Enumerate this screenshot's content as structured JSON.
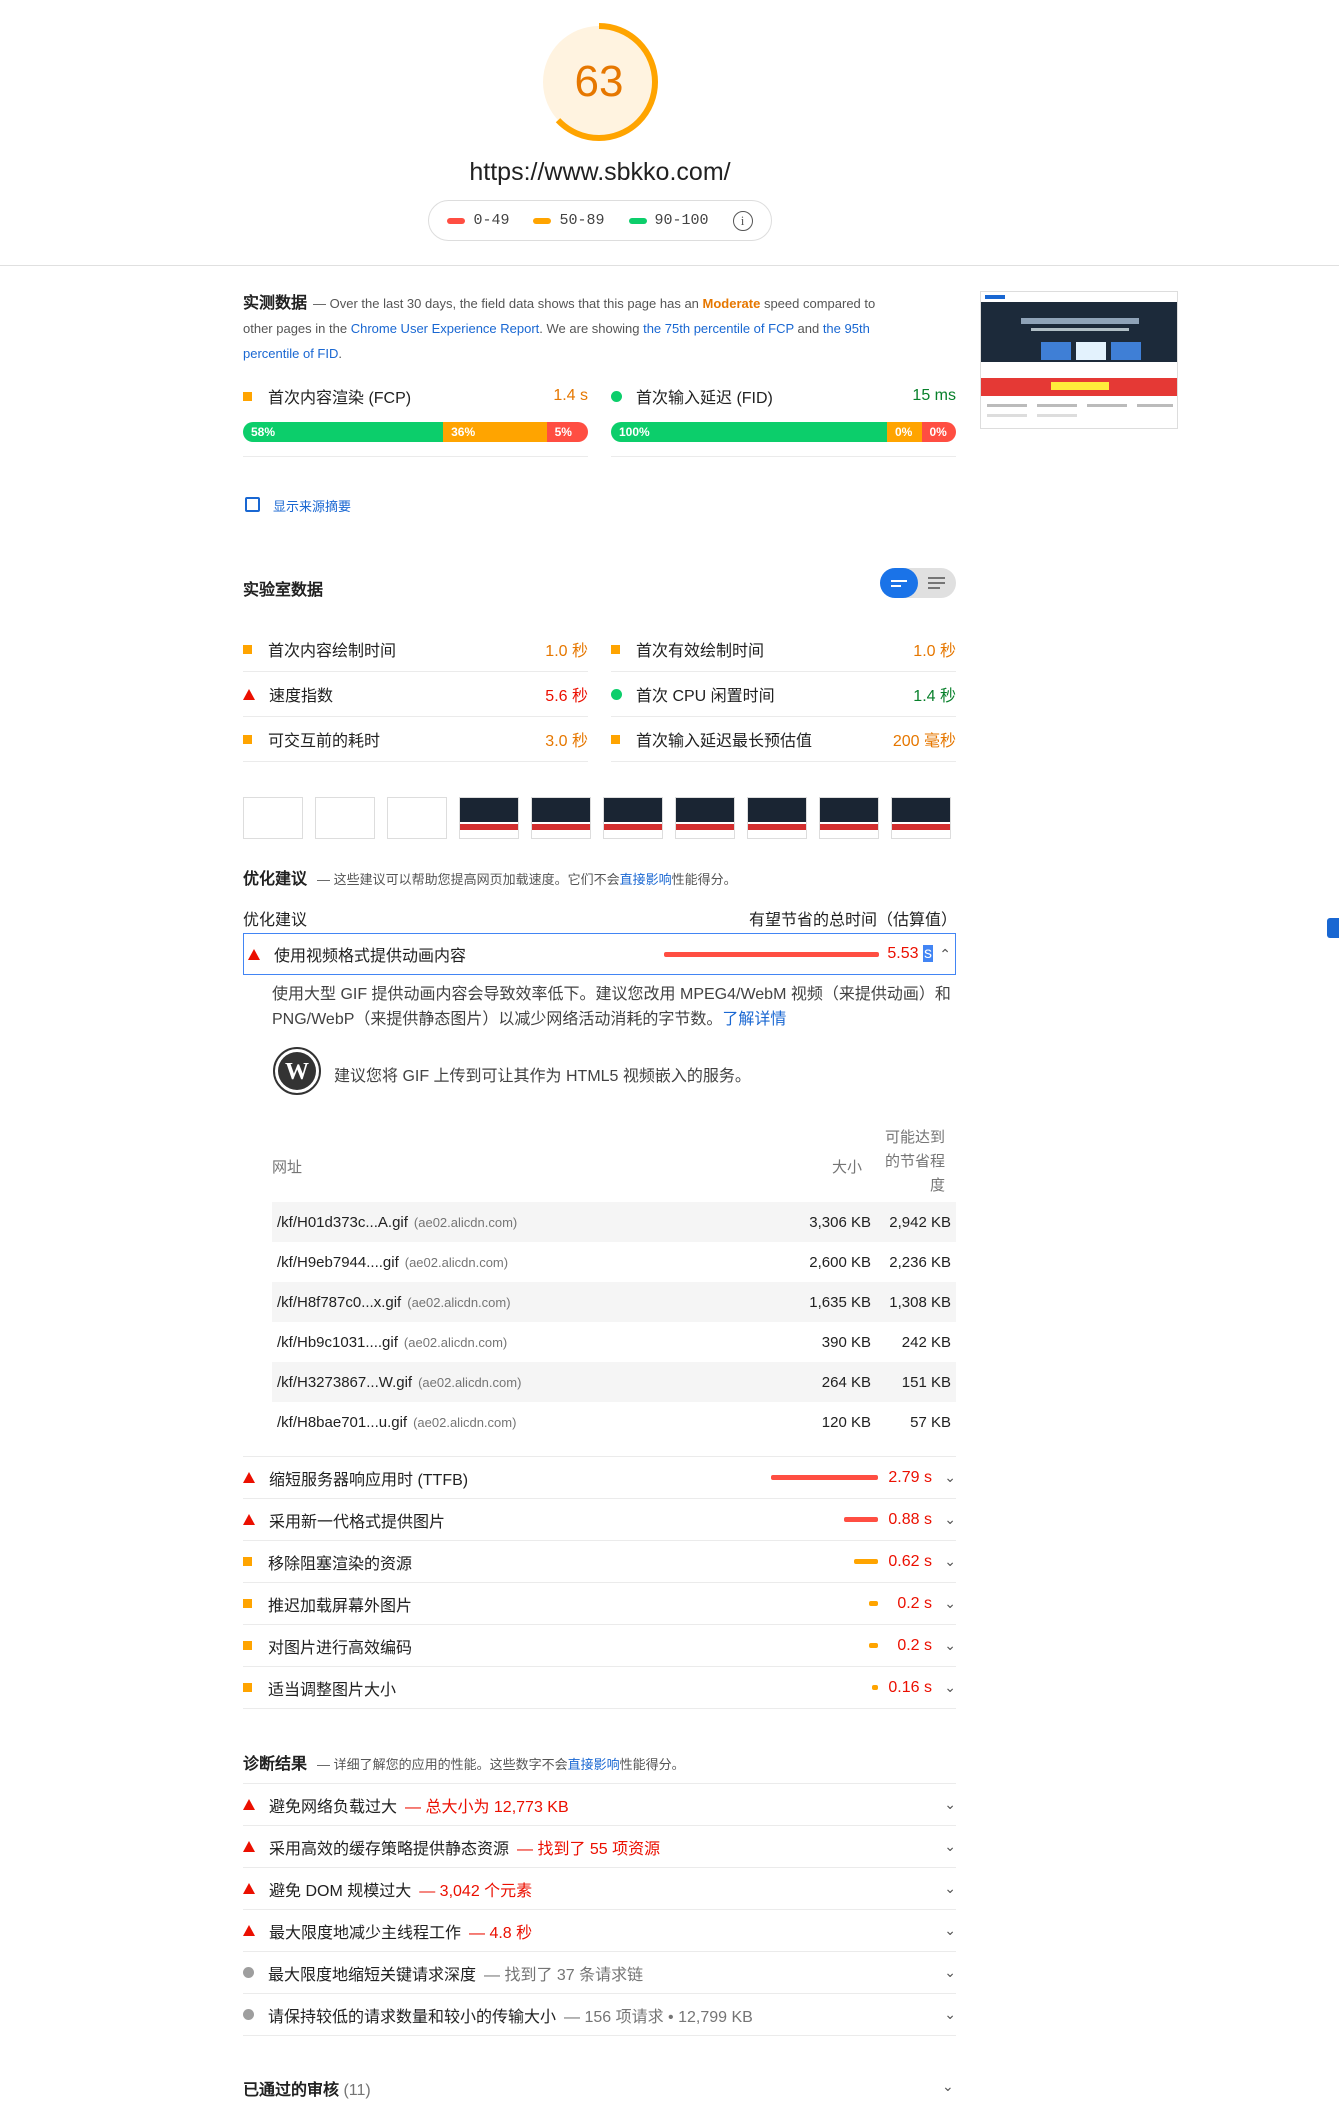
{
  "header": {
    "score": "63",
    "url": "https://www.sbkko.com/",
    "legend": [
      {
        "label": "0-49",
        "color": "#ff4e42"
      },
      {
        "label": "50-89",
        "color": "#ffa400"
      },
      {
        "label": "90-100",
        "color": "#0cce6b"
      }
    ],
    "info_icon": "i"
  },
  "field": {
    "title": "实测数据",
    "desc_part1": "— Over the last 30 days, the field data shows that this page has an ",
    "desc_moderate": "Moderate",
    "desc_part2": " speed compared to other pages in the ",
    "desc_link1": "Chrome User Experience Report",
    "desc_part3": ". We are showing ",
    "desc_link2": "the 75th percentile of FCP",
    "desc_part4": " and ",
    "desc_link3": "the 95th percentile of FID",
    "desc_part5": ".",
    "fcp": {
      "label": "首次内容渲染 (FCP)",
      "value": "1.4 s",
      "dist": [
        "58%",
        "36%",
        "5%"
      ]
    },
    "fid": {
      "label": "首次输入延迟 (FID)",
      "value": "15 ms",
      "dist": [
        "100%",
        "0%",
        "0%"
      ]
    },
    "origin_summary": "显示来源摘要"
  },
  "lab": {
    "title": "实验室数据",
    "metrics": [
      {
        "label": "首次内容绘制时间",
        "value": "1.0 秒",
        "status": "orange"
      },
      {
        "label": "首次有效绘制时间",
        "value": "1.0 秒",
        "status": "orange"
      },
      {
        "label": "速度指数",
        "value": "5.6 秒",
        "status": "red"
      },
      {
        "label": "首次 CPU 闲置时间",
        "value": "1.4 秒",
        "status": "green"
      },
      {
        "label": "可交互前的耗时",
        "value": "3.0 秒",
        "status": "orange"
      },
      {
        "label": "首次输入延迟最长预估值",
        "value": "200 毫秒",
        "status": "orange"
      }
    ]
  },
  "opportunities": {
    "title": "优化建议",
    "desc_part1": "— 这些建议可以帮助您提高网页加载速度。它们不会",
    "desc_link": "直接影响",
    "desc_part2": "性能得分。",
    "col_left": "优化建议",
    "col_right": "有望节省的总时间（估算值）",
    "expanded": {
      "label": "使用视频格式提供动画内容",
      "value_num": "5.53",
      "value_unit": "s",
      "text_part1": "使用大型 GIF 提供动画内容会导致效率低下。建议您改用 MPEG4/WebM 视频（来提供动画）和 PNG/WebP（来提供静态图片）以减少网络活动消耗的字节数。",
      "text_link": "了解详情",
      "wp_text": "建议您将 GIF 上传到可让其作为 HTML5 视频嵌入的服务。",
      "table_head": {
        "url": "网址",
        "size": "大小",
        "savings_1": "可能达到",
        "savings_2": "的节省程",
        "savings_3": "度"
      },
      "rows": [
        {
          "url": "/kf/H01d373c...A.gif",
          "host": "(ae02.alicdn.com)",
          "size": "3,306 KB",
          "save": "2,942 KB"
        },
        {
          "url": "/kf/H9eb7944....gif",
          "host": "(ae02.alicdn.com)",
          "size": "2,600 KB",
          "save": "2,236 KB"
        },
        {
          "url": "/kf/H8f787c0...x.gif",
          "host": "(ae02.alicdn.com)",
          "size": "1,635 KB",
          "save": "1,308 KB"
        },
        {
          "url": "/kf/Hb9c1031....gif",
          "host": "(ae02.alicdn.com)",
          "size": "390 KB",
          "save": "242 KB"
        },
        {
          "url": "/kf/H3273867...W.gif",
          "host": "(ae02.alicdn.com)",
          "size": "264 KB",
          "save": "151 KB"
        },
        {
          "url": "/kf/H8bae701...u.gif",
          "host": "(ae02.alicdn.com)",
          "size": "120 KB",
          "save": "57 KB"
        }
      ]
    },
    "items": [
      {
        "label": "缩短服务器响应用时 (TTFB)",
        "value": "2.79 s",
        "status": "red",
        "savings_fraction": 0.5
      },
      {
        "label": "采用新一代格式提供图片",
        "value": "0.88 s",
        "status": "red",
        "savings_fraction": 0.16
      },
      {
        "label": "移除阻塞渲染的资源",
        "value": "0.62 s",
        "status": "orange",
        "savings_fraction": 0.11
      },
      {
        "label": "推迟加载屏幕外图片",
        "value": "0.2 s",
        "status": "orange",
        "savings_fraction": 0.04
      },
      {
        "label": "对图片进行高效编码",
        "value": "0.2 s",
        "status": "orange",
        "savings_fraction": 0.04
      },
      {
        "label": "适当调整图片大小",
        "value": "0.16 s",
        "status": "orange",
        "savings_fraction": 0.03
      }
    ]
  },
  "diagnostics": {
    "title": "诊断结果",
    "desc_part1": "— 详细了解您的应用的性能。这些数字不会",
    "desc_link": "直接影响",
    "desc_part2": "性能得分。",
    "items": [
      {
        "label": "避免网络负载过大",
        "extra": "— 总大小为 12,773 KB",
        "status": "red"
      },
      {
        "label": "采用高效的缓存策略提供静态资源",
        "extra": "— 找到了 55 项资源",
        "status": "red"
      },
      {
        "label": "避免 DOM 规模过大",
        "extra": "— 3,042 个元素",
        "status": "red"
      },
      {
        "label": "最大限度地减少主线程工作",
        "extra": "— 4.8 秒",
        "status": "red"
      },
      {
        "label": "最大限度地缩短关键请求深度",
        "extra": "— 找到了 37 条请求链",
        "status": "grey"
      },
      {
        "label": "请保持较低的请求数量和较小的传输大小",
        "extra": "— 156 项请求 • 12,799 KB",
        "status": "grey"
      }
    ]
  },
  "passed": {
    "title": "已通过的审核",
    "count": "(11)"
  },
  "colors": {
    "red": "#eb0f00",
    "orange": "#e67700",
    "green": "#08802b",
    "bar_red": "#ff4e42",
    "bar_orange": "#ffa400",
    "bar_green": "#0cce6b",
    "link": "#1967d2"
  }
}
